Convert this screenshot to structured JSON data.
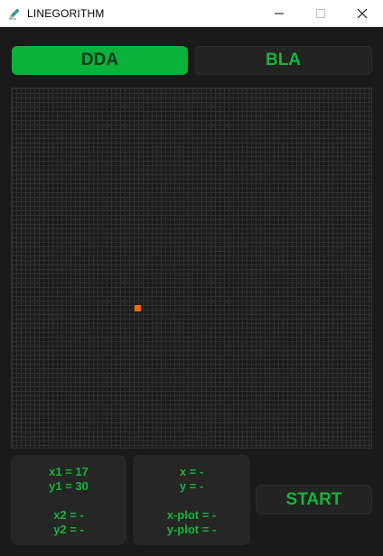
{
  "window": {
    "title": "LINEGORITHM",
    "icons": {
      "app": "pencil-icon",
      "minimize": "minimize-icon",
      "maximize": "maximize-icon",
      "close": "close-icon"
    }
  },
  "tabs": [
    {
      "label": "DDA",
      "selected": true
    },
    {
      "label": "BLA",
      "selected": false
    }
  ],
  "grid": {
    "columns": 80,
    "rows": 80,
    "plotted_points": [
      {
        "x": 17,
        "y": 30,
        "color": "#ff6a00"
      }
    ]
  },
  "coords_panel": {
    "x1": "x1 = 17",
    "y1": "y1 = 30",
    "x2": "x2 = -",
    "y2": "y2 = -"
  },
  "vars_panel": {
    "x": "x = -",
    "y": "y = -",
    "x_plot": "x-plot = -",
    "y_plot": "y-plot = -"
  },
  "start_label": "START",
  "colors": {
    "accent": "#0ab23c",
    "text_green": "#16b43a",
    "background": "#1a1a1a",
    "panel": "#262626",
    "plotted_pixel": "#ff6a00"
  }
}
